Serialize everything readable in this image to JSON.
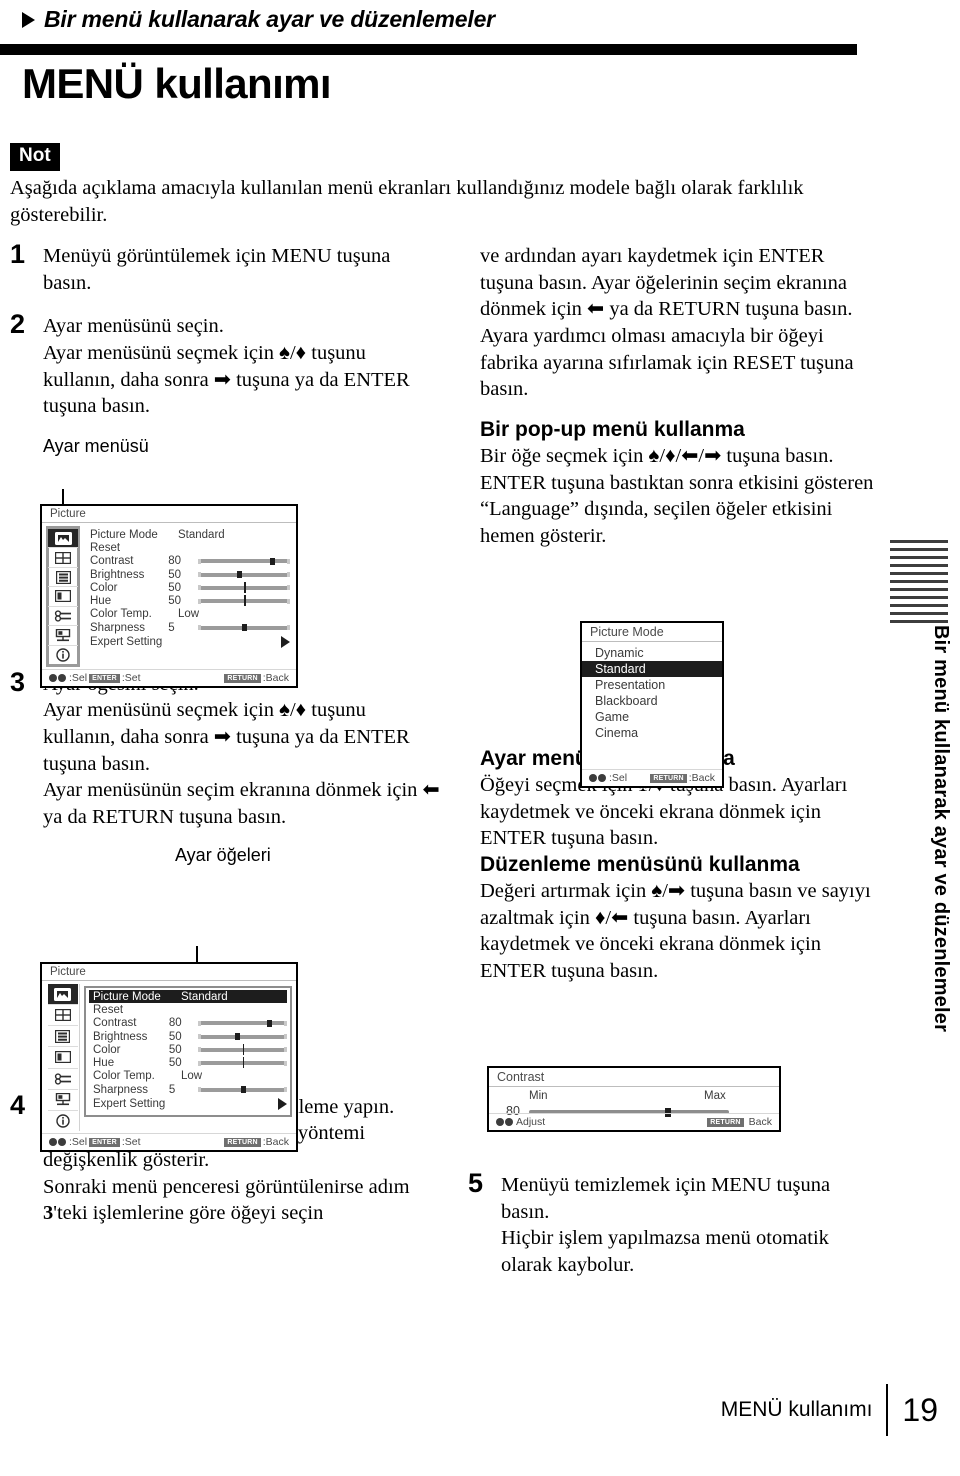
{
  "header": {
    "chapter": "Bir menü kullanarak ayar ve düzenlemeler",
    "title": "MENÜ kullanımı"
  },
  "note": {
    "badge": "Not",
    "text": "Aşağıda açıklama amacıyla kullanılan menü ekranları kullandığınız modele bağlı olarak farklılık gösterebilir."
  },
  "steps": {
    "s1": {
      "num": "1",
      "line1": "Menüyü görüntülemek için MENU tuşuna basın."
    },
    "s2": {
      "num": "2",
      "line1": "Ayar menüsünü seçin.",
      "line2": "Ayar menüsünü seçmek için ♠/♦ tuşunu kullanın, daha sonra ➡ tuşuna ya da ENTER tuşuna basın.",
      "caption": "Ayar menüsü"
    },
    "s3": {
      "num": "3",
      "line1": "Ayar öğesini seçin.",
      "line2": "Ayar menüsünü seçmek için ♠/♦ tuşunu kullanın, daha sonra ➡ tuşuna ya da ENTER tuşuna basın.",
      "line3": "Ayar menüsünün seçim ekranına dönmek için ⬅ ya da RETURN tuşuna basın.",
      "caption": "Ayar öğeleri"
    },
    "s4": {
      "num": "4",
      "line1": "Seçili öğe için ayar veya düzenleme yapın.",
      "line2": "Ayar öğesine bağlı olarak ayar yöntemi değişkenlik gösterir.",
      "line3a": "Sonraki menü penceresi görüntülenirse adım ",
      "line3b": "3",
      "line3c": "'teki işlemlerine göre öğeyi seçin"
    },
    "s5": {
      "num": "5",
      "line1": "Menüyü temizlemek için MENU tuşuna basın.",
      "line2": "Hiçbir işlem yapılmazsa menü otomatik olarak kaybolur."
    }
  },
  "right_column": {
    "cont_top": "ve ardından ayarı kaydetmek için ENTER tuşuna basın. Ayar öğelerinin seçim ekranına dönmek için ⬅ ya da RETURN tuşuna basın. Ayara yardımcı olması amacıyla bir öğeyi fabrika ayarına sıfırlamak için RESET tuşuna basın.",
    "popup_heading": "Bir pop-up menü kullanma",
    "popup_body": "Bir öğe seçmek için ♠/♦/⬅/➡ tuşuna basın. ENTER tuşuna bastıktan sonra etkisini gösteren “Language” dışında, seçilen öğeler etkisini hemen gösterir.",
    "setting_heading": "Ayar menüsünü kullanma",
    "setting_body": "Öğeyi seçmek için ♠/♦ tuşuna basın. Ayarları kaydetmek ve önceki ekrana dönmek için ENTER tuşuna basın.",
    "edit_heading": "Düzenleme menüsünü kullanma",
    "edit_body": "Değeri artırmak için ♠/➡ tuşuna basın ve sayıyı azaltmak için ♦/⬅ tuşuna basın. Ayarları kaydetmek ve önceki ekrana dönmek için ENTER tuşuna basın."
  },
  "osd_picture_menu": {
    "title": "Picture",
    "sidebar_icons": [
      "picture-icon",
      "screen-grid-icon",
      "settings-list-icon",
      "pip-layout-icon",
      "input-connector-icon",
      "installation-icon",
      "information-icon"
    ],
    "rows": [
      {
        "label": "Picture Mode",
        "value": "Standard",
        "kind": "text"
      },
      {
        "label": "Reset",
        "value": "",
        "kind": "none"
      },
      {
        "label": "Contrast",
        "value": "80",
        "kind": "slider",
        "pos": 78
      },
      {
        "label": "Brightness",
        "value": "50",
        "kind": "slider",
        "pos": 42
      },
      {
        "label": "Color",
        "value": "50",
        "kind": "tick",
        "pos": 50
      },
      {
        "label": "Hue",
        "value": "50",
        "kind": "tick",
        "pos": 50
      },
      {
        "label": "Color Temp.",
        "value": "Low",
        "kind": "text"
      },
      {
        "label": "Sharpness",
        "value": "5",
        "kind": "slider",
        "pos": 48
      },
      {
        "label": "Expert Setting",
        "value": "",
        "kind": "arrow"
      }
    ],
    "footer": {
      "sel_label": ":Sel",
      "enter_key": "ENTER",
      "set_label": ":Set",
      "return_key": "RETURN",
      "back_label": ":Back"
    }
  },
  "osd_popup_menu": {
    "title": "Picture Mode",
    "options": [
      "Dynamic",
      "Standard",
      "Presentation",
      "Blackboard",
      "Game",
      "Cinema"
    ],
    "selected": "Standard",
    "footer": {
      "sel_label": ":Sel",
      "return_key": "RETURN",
      "back_label": ":Back"
    }
  },
  "osd_contrast_bar": {
    "title": "Contrast",
    "value": "80",
    "min_label": "Min",
    "max_label": "Max",
    "pos": 68,
    "footer": {
      "adjust_label": "Adjust",
      "return_key": "RETURN",
      "back_label": "Back"
    }
  },
  "side_tab": {
    "text": "Bir menü kullanarak ayar ve düzenlemeler"
  },
  "footer": {
    "label": "MENÜ kullanımı",
    "page": "19"
  }
}
